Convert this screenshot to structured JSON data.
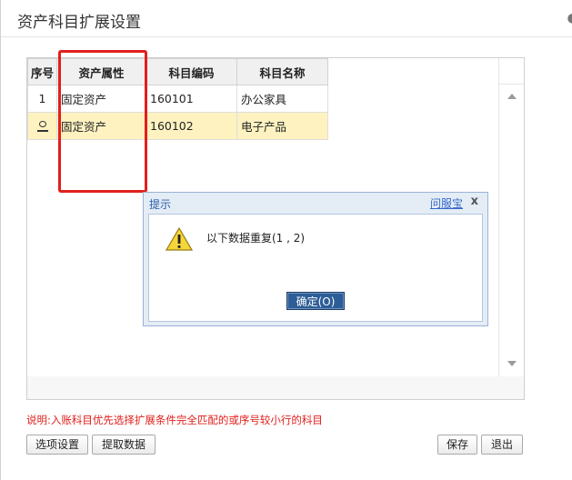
{
  "dialog": {
    "title": "资产科目扩展设置"
  },
  "grid": {
    "headers": [
      "序号",
      "资产属性",
      "科目编码",
      "科目名称"
    ],
    "rows": [
      {
        "index": "1",
        "attribute": "固定资产",
        "code": "160101",
        "name": "办公家具"
      },
      {
        "index": "",
        "attribute": "固定资产",
        "code": "160102",
        "name": "电子产品"
      }
    ]
  },
  "popup": {
    "title": "提示",
    "link": "问服宝",
    "close": "x",
    "message": "以下数据重复(1 , 2)",
    "ok_label": "确定(O)"
  },
  "note": "说明:入账科目优先选择扩展条件完全匹配的或序号较小行的科目",
  "buttons": {
    "options": "选项设置",
    "fetch": "提取数据",
    "save": "保存",
    "exit": "退出"
  },
  "colors": {
    "highlight_box": "#e0201c",
    "selected_row": "#fdf2c0",
    "ok_button": "#2d5d96"
  }
}
